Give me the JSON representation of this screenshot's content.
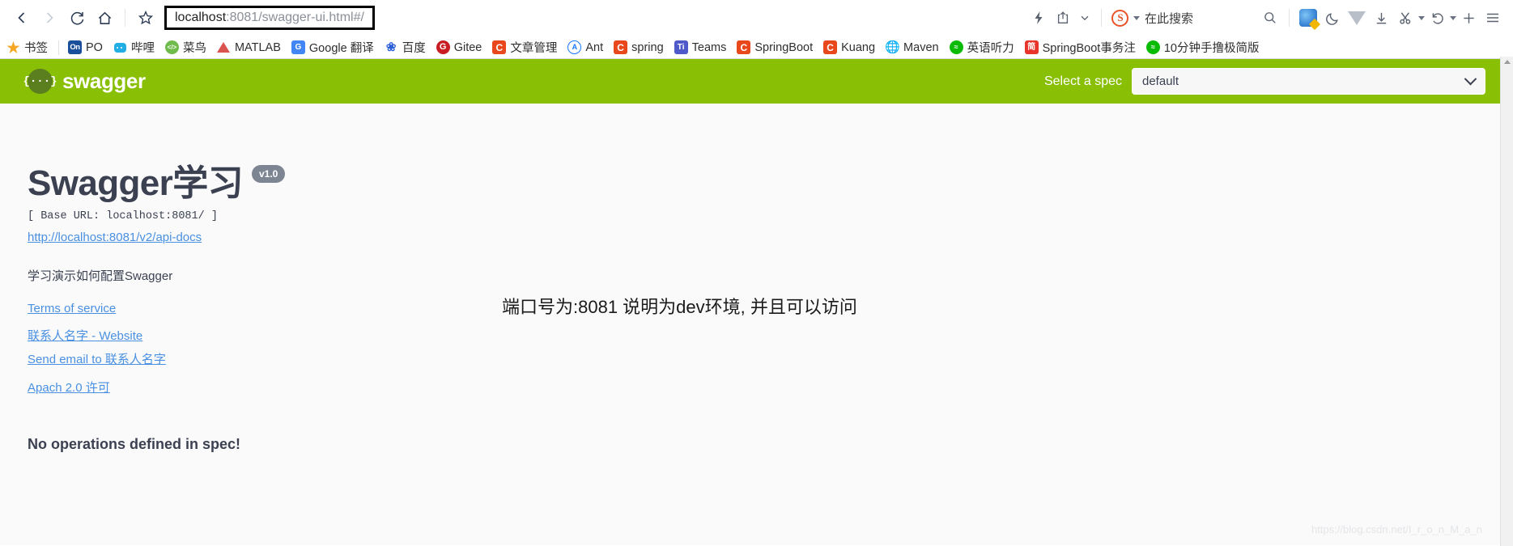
{
  "browser": {
    "nav": {
      "back": "back-arrow",
      "forward": "forward-arrow",
      "reload": "reload",
      "home": "home",
      "bookmark_star": "star"
    },
    "url": {
      "prefix": "localhost",
      "port": ":8081",
      "path": "/swagger-ui.html#/",
      "full": "localhost:8081/swagger-ui.html#/"
    },
    "right_tools": {
      "search_engine_badge": "S",
      "search_placeholder": "在此搜索",
      "icons": [
        "lightning-icon",
        "share-icon",
        "chevron-down-icon",
        "sogou-icon",
        "search-icon",
        "translate-icon",
        "moon-icon",
        "vimeo-v-icon",
        "download-icon",
        "scissors-icon",
        "undo-icon",
        "plus-icon",
        "menu-icon"
      ]
    },
    "bookmarks": [
      {
        "label": "书签",
        "icon": "star-icon",
        "cls": "ic-star",
        "glyph": "★"
      },
      {
        "label": "PO",
        "icon": "onenote-icon",
        "cls": "ic-on",
        "glyph": "On"
      },
      {
        "label": "哔哩",
        "icon": "bilibili-icon",
        "cls": "ic-bili",
        "glyph": ""
      },
      {
        "label": "菜鸟",
        "icon": "runoob-icon",
        "cls": "ic-cn",
        "glyph": "</>"
      },
      {
        "label": "MATLAB",
        "icon": "matlab-icon",
        "cls": "ic-matlab",
        "glyph": ""
      },
      {
        "label": "Google 翻译",
        "icon": "google-translate-icon",
        "cls": "ic-google",
        "glyph": "G"
      },
      {
        "label": "百度",
        "icon": "baidu-icon",
        "cls": "ic-baidu",
        "glyph": "❀"
      },
      {
        "label": "Gitee",
        "icon": "gitee-icon",
        "cls": "ic-gitee",
        "glyph": "G"
      },
      {
        "label": "文章管理",
        "icon": "csdn-icon",
        "cls": "ic-c",
        "glyph": "C"
      },
      {
        "label": "Ant",
        "icon": "ant-design-icon",
        "cls": "ic-ant",
        "glyph": "A"
      },
      {
        "label": "spring",
        "icon": "csdn-icon",
        "cls": "ic-c",
        "glyph": "C"
      },
      {
        "label": "Teams",
        "icon": "teams-icon",
        "cls": "ic-teams",
        "glyph": "Ti"
      },
      {
        "label": "SpringBoot",
        "icon": "csdn-icon",
        "cls": "ic-c",
        "glyph": "C"
      },
      {
        "label": "Kuang",
        "icon": "csdn-icon",
        "cls": "ic-c",
        "glyph": "C"
      },
      {
        "label": "Maven",
        "icon": "globe-icon",
        "cls": "ic-globe",
        "glyph": "🌐"
      },
      {
        "label": "英语听力",
        "icon": "wechat-icon",
        "cls": "ic-wechat",
        "glyph": "≈"
      },
      {
        "label": "SpringBoot事务注",
        "icon": "jianshu-icon",
        "cls": "ic-jian",
        "glyph": "简"
      },
      {
        "label": "10分钟手撸极简版",
        "icon": "wechat-icon",
        "cls": "ic-wechat",
        "glyph": "≈"
      }
    ]
  },
  "swagger": {
    "logo_glyph": "{···}",
    "logo_text": "swagger",
    "spec_label": "Select a spec",
    "spec_selected": "default",
    "spec_options": [
      "default"
    ],
    "title": "Swagger学习",
    "version_badge": "v1.0",
    "base_url": "[ Base URL: localhost:8081/ ]",
    "api_docs_link": "http://localhost:8081/v2/api-docs",
    "description": "学习演示如何配置Swagger",
    "links": [
      {
        "label": "Terms of service",
        "name": "terms-of-service-link"
      },
      {
        "label": "联系人名字 - Website",
        "name": "contact-website-link"
      },
      {
        "label": "Send email to 联系人名字",
        "name": "contact-email-link"
      },
      {
        "label": "Apach 2.0 许可",
        "name": "license-link"
      }
    ],
    "no_operations": "No operations defined in spec!"
  },
  "annotation": {
    "text": "端口号为:8081 说明为dev环境, 并且可以访问",
    "arrow_color": "#ef8236"
  },
  "watermark": "https://blog.csdn.net/I_r_o_n_M_a_n",
  "colors": {
    "swagger_green": "#89bf04",
    "link_blue": "#4990e2",
    "text_dark": "#3b4151",
    "annotation_orange": "#ef8236"
  }
}
